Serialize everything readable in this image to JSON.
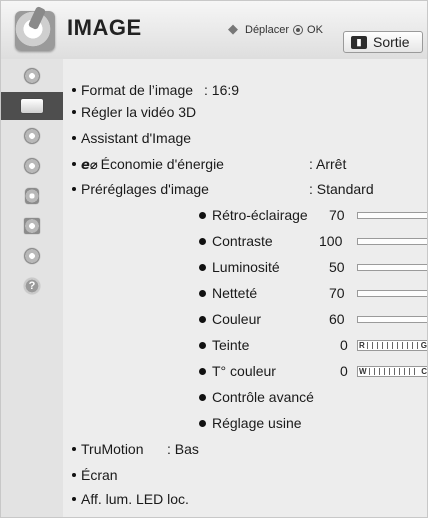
{
  "header": {
    "title": "IMAGE",
    "hint_move": "Déplacer",
    "hint_ok": "OK",
    "exit_key": "▮",
    "exit_label": "Sortie"
  },
  "sidebar": {
    "items": [
      {
        "icon": "satellite-dish-icon",
        "active": false
      },
      {
        "icon": "tv-screen-icon",
        "active": true
      },
      {
        "icon": "speaker-icon",
        "active": false
      },
      {
        "icon": "clock-icon",
        "active": false
      },
      {
        "icon": "lock-icon",
        "active": false
      },
      {
        "icon": "options-box-icon",
        "active": false
      },
      {
        "icon": "network-globe-icon",
        "active": false
      },
      {
        "icon": "help-icon",
        "active": false
      }
    ],
    "help_glyph": "?"
  },
  "menu": {
    "format": {
      "label": "Format de l’image",
      "value": ": 16:9"
    },
    "video3d": {
      "label": "Régler la vidéo 3D"
    },
    "assistant": {
      "label": "Assistant d'Image"
    },
    "eco": {
      "icon_glyph": "e⌀",
      "label": "Économie d'énergie",
      "value": ": Arrêt"
    },
    "presets": {
      "label": "Préréglages d'image",
      "value": ": Standard"
    },
    "settings": [
      {
        "label": "Rétro-éclairage",
        "value": "70",
        "level": 0.7,
        "type": "bar"
      },
      {
        "label": "Contraste",
        "value": "100",
        "level": 1.0,
        "type": "bar"
      },
      {
        "label": "Luminosité",
        "value": "50",
        "level": 0.5,
        "type": "bar"
      },
      {
        "label": "Netteté",
        "value": "70",
        "level": 0.7,
        "type": "bar"
      },
      {
        "label": "Couleur",
        "value": "60",
        "level": 0.6,
        "type": "bar"
      },
      {
        "label": "Teinte",
        "value": "0",
        "type": "scale",
        "left": "R",
        "right": "G"
      },
      {
        "label": "T° couleur",
        "value": "0",
        "type": "scale",
        "left": "W",
        "right": "C"
      }
    ],
    "advanced": {
      "label": "Contrôle avancé"
    },
    "reset": {
      "label": "Réglage usine"
    },
    "trumotion": {
      "label": "TruMotion",
      "value": ": Bas"
    },
    "screen": {
      "label": "Écran"
    },
    "led": {
      "label": "Aff. lum. LED loc."
    }
  },
  "colors": {
    "active_tab": "#4e4e4e",
    "bar_fill": "#3f3f3f"
  }
}
